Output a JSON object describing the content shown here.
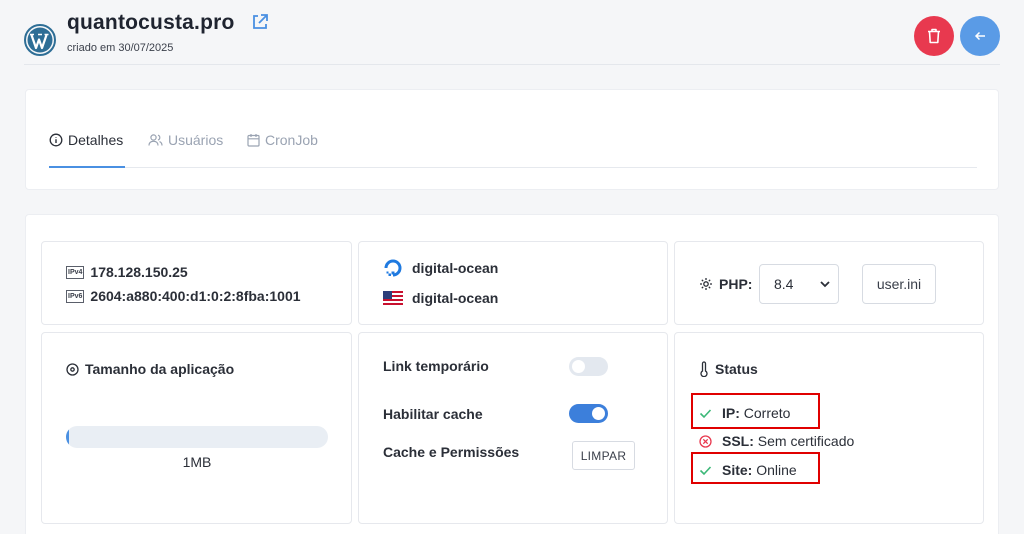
{
  "site": {
    "name": "quantocusta.pro",
    "created": "criado em 30/07/2025",
    "logo_icon": "wordpress-icon",
    "external_icon": "external-link-icon"
  },
  "actions": {
    "delete_icon": "trash-icon",
    "back_icon": "arrow-left-icon",
    "delete_color": "#e8394f",
    "back_color": "#5a9be6"
  },
  "tabs": [
    {
      "label": "Detalhes",
      "icon": "info-icon",
      "active": true
    },
    {
      "label": "Usuários",
      "icon": "users-icon",
      "active": false
    },
    {
      "label": "CronJob",
      "icon": "calendar-icon",
      "active": false
    }
  ],
  "network": {
    "ipv4_badge": "IPv4",
    "ipv4": "178.128.150.25",
    "ipv6_badge": "IPv6",
    "ipv6": "2604:a880:400:d1:0:2:8fba:1001"
  },
  "provider": {
    "host": "digital-ocean",
    "host_icon": "digitalocean-icon",
    "region": "digital-ocean",
    "region_icon": "us-flag-icon"
  },
  "php": {
    "label": "PHP:",
    "version": "8.4",
    "ini_button": "user.ini",
    "icon": "gear-icon"
  },
  "size": {
    "title": "Tamanho da aplicação",
    "value": "1MB",
    "progress_percent": 1,
    "icon": "disc-icon"
  },
  "options": {
    "temp_link_label": "Link temporário",
    "temp_link_enabled": false,
    "cache_label": "Habilitar cache",
    "cache_enabled": true,
    "perms_label": "Cache e Permissões",
    "clear_button": "LIMPAR"
  },
  "status": {
    "title": "Status",
    "icon": "thermometer-icon",
    "items": [
      {
        "key": "IP:",
        "value": "Correto",
        "state": "ok"
      },
      {
        "key": "SSL:",
        "value": "Sem certificado",
        "state": "error"
      },
      {
        "key": "Site:",
        "value": "Online",
        "state": "ok"
      }
    ]
  },
  "colors": {
    "accent": "#4a90e2",
    "ok": "#3cb878",
    "error": "#e8394f",
    "highlight": "#e00000"
  }
}
